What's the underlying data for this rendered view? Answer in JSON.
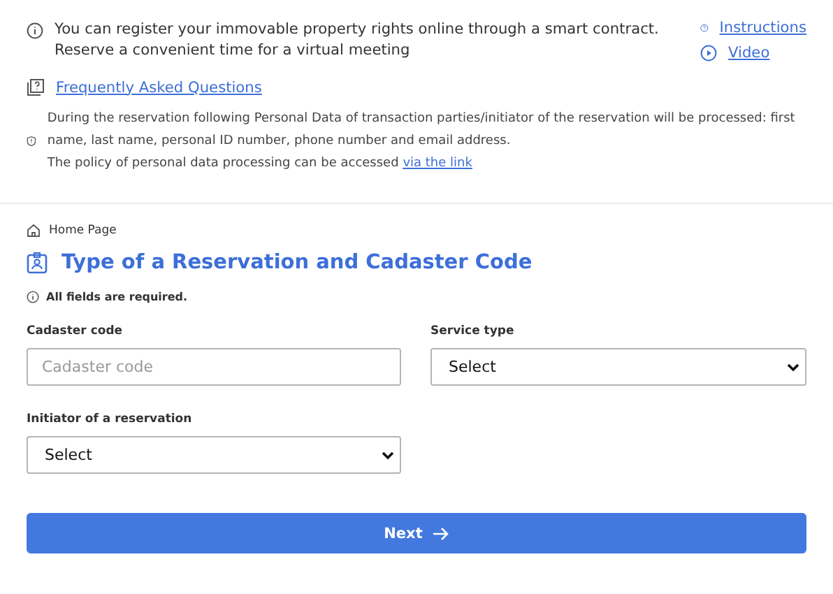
{
  "info": {
    "lines": [
      "You can register your immovable property rights online through a smart contract.",
      "Reserve a convenient time for a virtual meeting"
    ],
    "links": [
      {
        "kind": "help",
        "label": "Instructions"
      },
      {
        "kind": "video",
        "label": "Video"
      }
    ],
    "faq_link": "Frequently Asked Questions",
    "privacy_text": "During the reservation following Personal Data of transaction parties/initiator of the reservation will be processed: first name, last name, personal ID number, phone number and email address.",
    "policy_text": "The policy of personal data processing can be accessed",
    "policy_link": "via the link"
  },
  "breadcrumb": "Home Page",
  "title": "Type of a Reservation and Cadaster Code",
  "required_note": "All fields are required.",
  "fields": [
    {
      "kind": "text",
      "label": "Cadaster code",
      "placeholder": "Cadaster code"
    },
    {
      "kind": "select",
      "label": "Service type",
      "value": "Select"
    },
    {
      "kind": "select",
      "label": "Initiator of a reservation",
      "value": "Select"
    }
  ],
  "next_button": "Next"
}
